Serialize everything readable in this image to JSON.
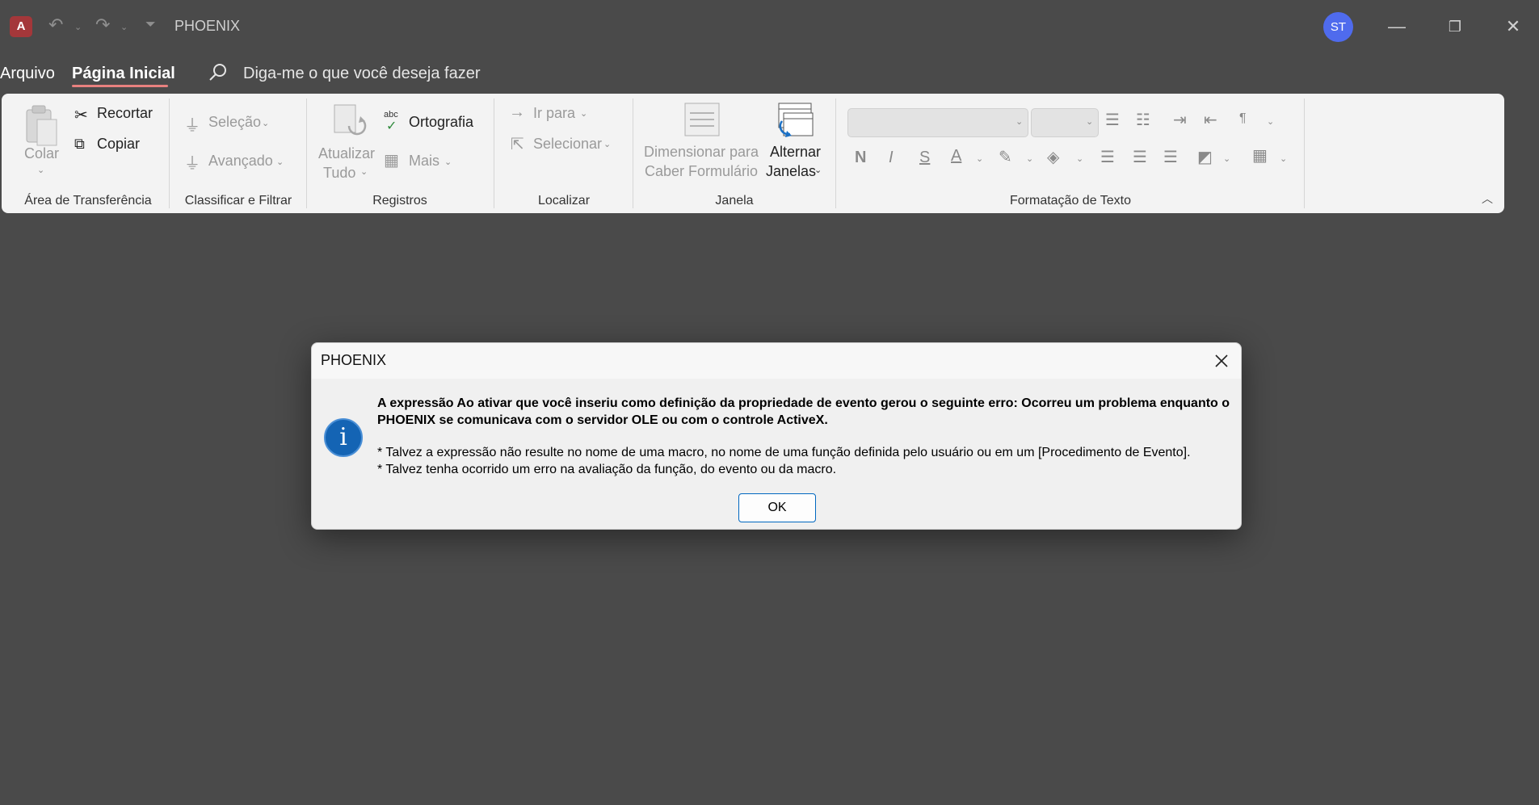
{
  "titlebar": {
    "app_icon_letter": "A",
    "title": "PHOENIX",
    "avatar_initials": "ST",
    "undo_icon": "undo-icon",
    "redo_icon": "redo-icon",
    "customize_icon": "customize-quick-access-icon"
  },
  "menu": {
    "file": "Arquivo",
    "home": "Página Inicial",
    "tell_me": "Diga-me o que você deseja fazer"
  },
  "ribbon": {
    "clipboard": {
      "label": "Área de Transferência",
      "paste": "Colar",
      "cut": "Recortar",
      "copy": "Copiar"
    },
    "sort_filter": {
      "label": "Classificar e Filtrar",
      "selection": "Seleção",
      "advanced": "Avançado"
    },
    "records": {
      "label": "Registros",
      "refresh_1": "Atualizar",
      "refresh_2": "Tudo",
      "spelling": "Ortografia",
      "more": "Mais"
    },
    "find": {
      "label": "Localizar",
      "goto": "Ir para",
      "select": "Selecionar"
    },
    "window": {
      "label": "Janela",
      "size_1": "Dimensionar para",
      "size_2": "Caber Formulário",
      "switch_1": "Alternar",
      "switch_2": "Janelas"
    },
    "text_format": {
      "label": "Formatação de Texto",
      "bold": "N",
      "italic": "I",
      "underline": "S"
    }
  },
  "dialog": {
    "title": "PHOENIX",
    "message_bold": "A expressão Ao ativar que você inseriu como definição da propriedade de evento gerou o seguinte erro: Ocorreu um problema enquanto o PHOENIX se comunicava com o servidor OLE ou com o controle ActiveX.",
    "line1": "* Talvez a expressão não resulte no nome de uma macro, no nome de uma função definida pelo usuário ou em um [Procedimento de Evento].",
    "line2": "* Talvez tenha ocorrido um erro na avaliação da função, do evento ou da macro.",
    "ok": "OK",
    "icon": "info-icon"
  },
  "colors": {
    "background": "#4a4a4a",
    "ribbon": "#f3f3f3",
    "avatar": "#4f6bed",
    "app_icon": "#a4373a",
    "accent_underline": "#e8817f",
    "info_icon": "#1464b4"
  }
}
